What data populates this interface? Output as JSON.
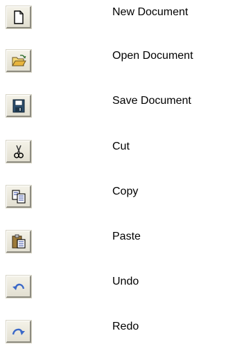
{
  "toolbar_legend": [
    {
      "icon": "new-document-icon",
      "label": "New Document"
    },
    {
      "icon": "open-folder-icon",
      "label": "Open Document"
    },
    {
      "icon": "save-disk-icon",
      "label": "Save Document"
    },
    {
      "icon": "scissors-icon",
      "label": "Cut"
    },
    {
      "icon": "copy-icon",
      "label": "Copy"
    },
    {
      "icon": "paste-clipboard-icon",
      "label": "Paste"
    },
    {
      "icon": "undo-arrow-icon",
      "label": "Undo"
    },
    {
      "icon": "redo-arrow-icon",
      "label": "Redo"
    }
  ],
  "colors": {
    "button_face": "#e2dfd1",
    "folder_yellow": "#e8c050",
    "disk_blue": "#2d4f6e",
    "arrow_blue": "#3a68c8"
  }
}
